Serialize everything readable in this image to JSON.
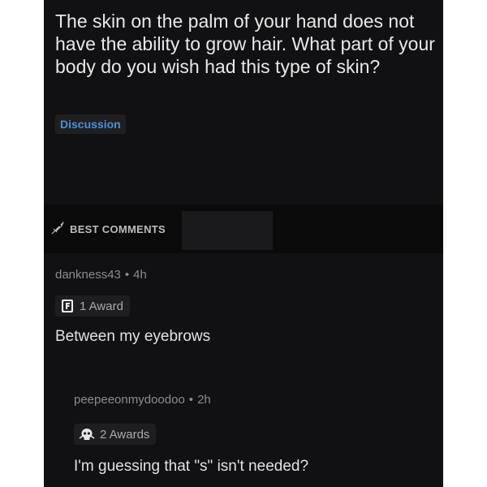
{
  "post": {
    "title": "The skin on the palm of your hand does not have the ability to grow hair. What part of your body do you wish had this type of skin?",
    "flair": "Discussion"
  },
  "sort": {
    "label": "BEST COMMENTS",
    "icon": "rocket-icon"
  },
  "comments": [
    {
      "author": "dankness43",
      "separator": "•",
      "time": "4h",
      "award": {
        "icon": "f-award-icon",
        "label": "1 Award"
      },
      "body": "Between my eyebrows"
    },
    {
      "author": "peepeeonmydoodoo",
      "separator": "•",
      "time": "2h",
      "award": {
        "icon": "skull-award-icon",
        "label": "2 Awards"
      },
      "body": "I'm guessing that \"s\" isn't needed?"
    }
  ],
  "colors": {
    "background": "#111113",
    "flair": "#4a90d9",
    "text": "#e2e2e2",
    "meta": "#8c8c8c"
  }
}
